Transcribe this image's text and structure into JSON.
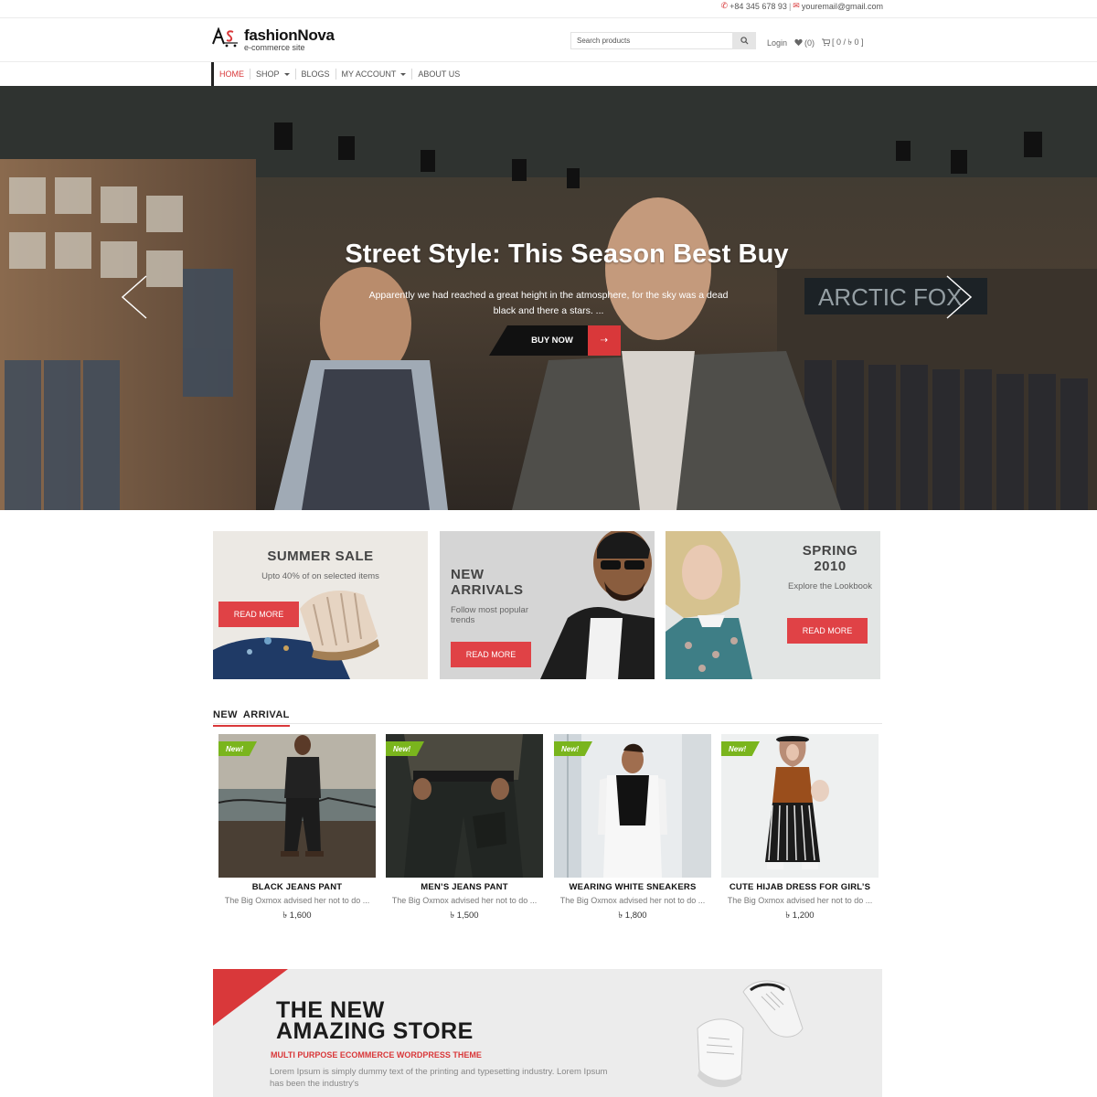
{
  "topbar": {
    "phone": "+84 345 678 93",
    "email": "youremail@gmail.com"
  },
  "header": {
    "logo_name": "fashionNova",
    "logo_tagline": "e-commerce site",
    "search_placeholder": "Search products",
    "login": "Login",
    "wishlist": "(0)",
    "cart": "[ 0 / ৳ 0 ]"
  },
  "nav": {
    "items": [
      {
        "label": "HOME",
        "active": true
      },
      {
        "label": "SHOP",
        "dropdown": true
      },
      {
        "label": "BLOGS"
      },
      {
        "label": "MY ACCOUNT",
        "dropdown": true
      },
      {
        "label": "ABOUT US"
      }
    ]
  },
  "hero": {
    "title": "Street Style: This Season Best Buy",
    "text": "Apparently we had reached a great height in the atmosphere, for the sky was a dead black and there a stars. ...",
    "button": "BUY NOW"
  },
  "promos": [
    {
      "title": "SUMMER SALE",
      "subtitle": "Upto 40% of on selected items",
      "button": "READ MORE"
    },
    {
      "title_line1": "NEW",
      "title_line2": "ARRIVALS",
      "subtitle": "Follow most popular trends",
      "button": "READ MORE"
    },
    {
      "title_line1": "SPRING",
      "title_line2": "2010",
      "subtitle": "Explore the Lookbook",
      "button": "READ MORE"
    }
  ],
  "new_arrival": {
    "heading": "NEW ARRIVAL",
    "badge": "New!",
    "products": [
      {
        "name": "BLACK JEANS PANT",
        "desc": "The Big Oxmox advised her not to do ...",
        "price": "৳ 1,600"
      },
      {
        "name": "MEN’S JEANS PANT",
        "desc": "The Big Oxmox advised her not to do ...",
        "price": "৳ 1,500"
      },
      {
        "name": "WEARING WHITE SNEAKERS",
        "desc": "The Big Oxmox advised her not to do ...",
        "price": "৳ 1,800"
      },
      {
        "name": "CUTE HIJAB DRESS FOR GIRL’S",
        "desc": "The Big Oxmox advised her not to do ...",
        "price": "৳ 1,200"
      }
    ]
  },
  "banner": {
    "title_line1": "THE NEW",
    "title_line2": "AMAZING STORE",
    "subtitle": "MULTI PURPOSE ECOMMERCE WORDPRESS THEME",
    "text": "Lorem Ipsum is simply dummy text of the printing and typesetting industry. Lorem Ipsum has been the industry's"
  },
  "colors": {
    "accent": "#d9383a",
    "badge": "#7ab51d",
    "dark": "#111111"
  }
}
